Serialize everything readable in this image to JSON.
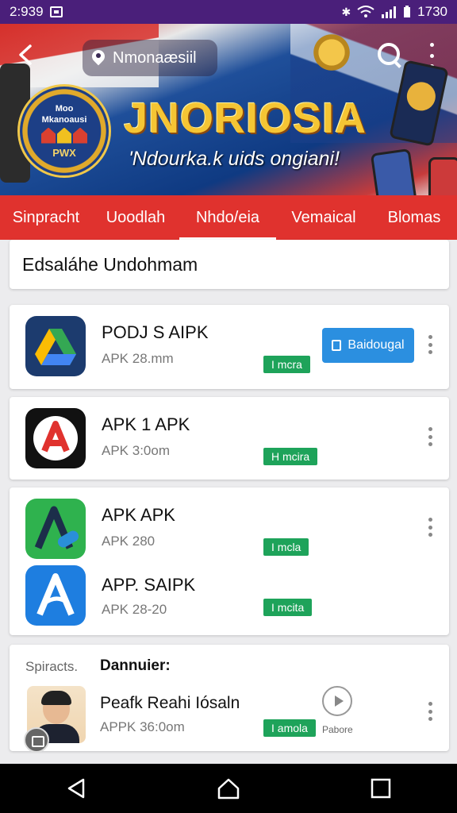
{
  "status_bar": {
    "time_left": "2:939",
    "time_right": "1730"
  },
  "header": {
    "search_text": "Nmonaæsiil",
    "banner_title": "JNORIOSIA",
    "banner_subtitle": "'Ndourka.k uids ongiani!",
    "logo_lines": [
      "Moo",
      "Mkanoausi",
      "PWX"
    ]
  },
  "tabs": [
    {
      "label": "Sinpracht",
      "active": false
    },
    {
      "label": "Uoodlah",
      "active": false
    },
    {
      "label": "Nhdo/eia",
      "active": true
    },
    {
      "label": "Vemaical",
      "active": false
    },
    {
      "label": "Blomas",
      "active": false
    }
  ],
  "section_header": "Edsaláhe Undohmam",
  "apps": [
    {
      "name": "PODJ S AIPK",
      "size": "APK 28.mm",
      "badge": "I mcra",
      "action": "Baidougal",
      "icon": "drive-icon"
    },
    {
      "name": "APK 1 APK",
      "size": "APK 3:0om",
      "badge": "H mcira",
      "icon": "acrobat-icon"
    },
    {
      "name": "APK APK",
      "size": "APK 280",
      "badge": "I mcla",
      "icon": "green-a-icon"
    },
    {
      "name": "APP. SAIPK",
      "size": "APK 28-20",
      "badge": "I mcita",
      "icon": "blue-a-icon"
    }
  ],
  "featured": {
    "label": "Spiracts.",
    "title": "Dannuier:",
    "name": "Peafk Reahi Iósaln",
    "size": "APPK 36:0om",
    "badge": "I amola",
    "action": "Pabore"
  }
}
